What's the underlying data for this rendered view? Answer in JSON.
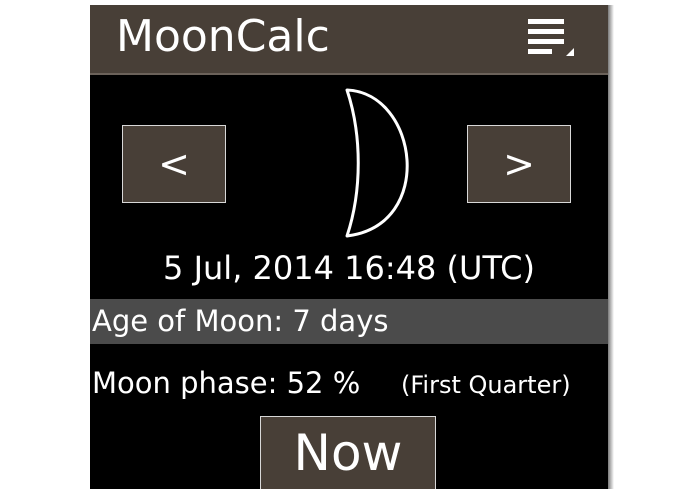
{
  "header": {
    "app_title": "MoonCalc",
    "menu_icon": "overflow-menu-icon"
  },
  "navigation": {
    "prev_label": "<",
    "next_label": ">"
  },
  "moon": {
    "icon": "moon-phase-first-quarter-icon",
    "phase_fraction": 0.52
  },
  "datetime": "5 Jul, 2014 16:48 (UTC)",
  "info": {
    "age_text": "Age of Moon: 7 days",
    "phase_text": "Moon phase: 52 %",
    "phase_name": "(First Quarter)"
  },
  "actions": {
    "now_label": "Now"
  },
  "colors": {
    "titlebar": "#483f37",
    "background": "#000000",
    "age_row": "#4b4b4b",
    "text": "#ffffff"
  }
}
